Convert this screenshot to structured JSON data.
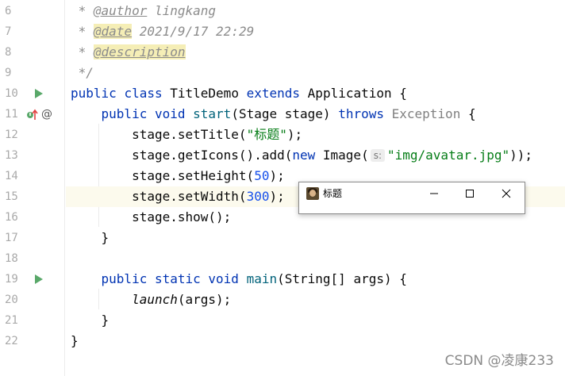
{
  "editor": {
    "line_numbers": [
      "6",
      "7",
      "8",
      "9",
      "10",
      "11",
      "12",
      "13",
      "14",
      "15",
      "16",
      "17",
      "18",
      "19",
      "20",
      "21",
      "22"
    ],
    "lines": {
      "l6": {
        "prefix": " * ",
        "tag": "@author",
        "text": " lingkang"
      },
      "l7": {
        "prefix": " * ",
        "tag": "@date",
        "text": " 2021/9/17 22:29"
      },
      "l8": {
        "prefix": " * ",
        "tag": "@description"
      },
      "l9": {
        "text": " */"
      },
      "l10": {
        "kw1": "public",
        "kw2": "class",
        "name": "TitleDemo",
        "kw3": "extends",
        "parent": "Application {"
      },
      "l11": {
        "kw1": "public",
        "kw2": "void",
        "method": "start",
        "params": "(Stage stage)",
        "kw3": "throws",
        "exc": "Exception",
        "brace": "{"
      },
      "l12": {
        "a": "stage.setTitle(",
        "str": "\"标题\"",
        "b": ");"
      },
      "l13": {
        "a": "stage.getIcons().add(",
        "kw": "new",
        "b": " Image(",
        "hint": "s:",
        "str": "\"img/avatar.jpg\"",
        "c": "));"
      },
      "l14": {
        "a": "stage.setHeight(",
        "num": "50",
        "b": ");"
      },
      "l15": {
        "a": "stage.setWidth(",
        "num": "300",
        "b": ");"
      },
      "l16": {
        "a": "stage.show();"
      },
      "l17": {
        "a": "}"
      },
      "l19": {
        "kw1": "public",
        "kw2": "static",
        "kw3": "void",
        "method": "main",
        "params": "(String[] args) {"
      },
      "l20": {
        "call": "launch",
        "args": "(args);"
      },
      "l21": {
        "a": "}"
      },
      "l22": {
        "a": "}"
      }
    },
    "current_line": "15"
  },
  "gutter_icons": {
    "run": "run-triangle-icon",
    "override": "override-arrow-icon",
    "annotation": "at-sign-icon",
    "override_symbol": "@"
  },
  "window": {
    "title": "标题",
    "icon": "avatar-icon",
    "minimize": "minimize-icon",
    "maximize": "maximize-icon",
    "close": "close-icon"
  },
  "watermark": "CSDN @凌康233",
  "colors": {
    "keyword": "#0033b3",
    "string": "#067d17",
    "number": "#1750eb",
    "comment": "#8c8c8c",
    "current_line_bg": "#fcfaed",
    "run_icon": "#59a869"
  }
}
